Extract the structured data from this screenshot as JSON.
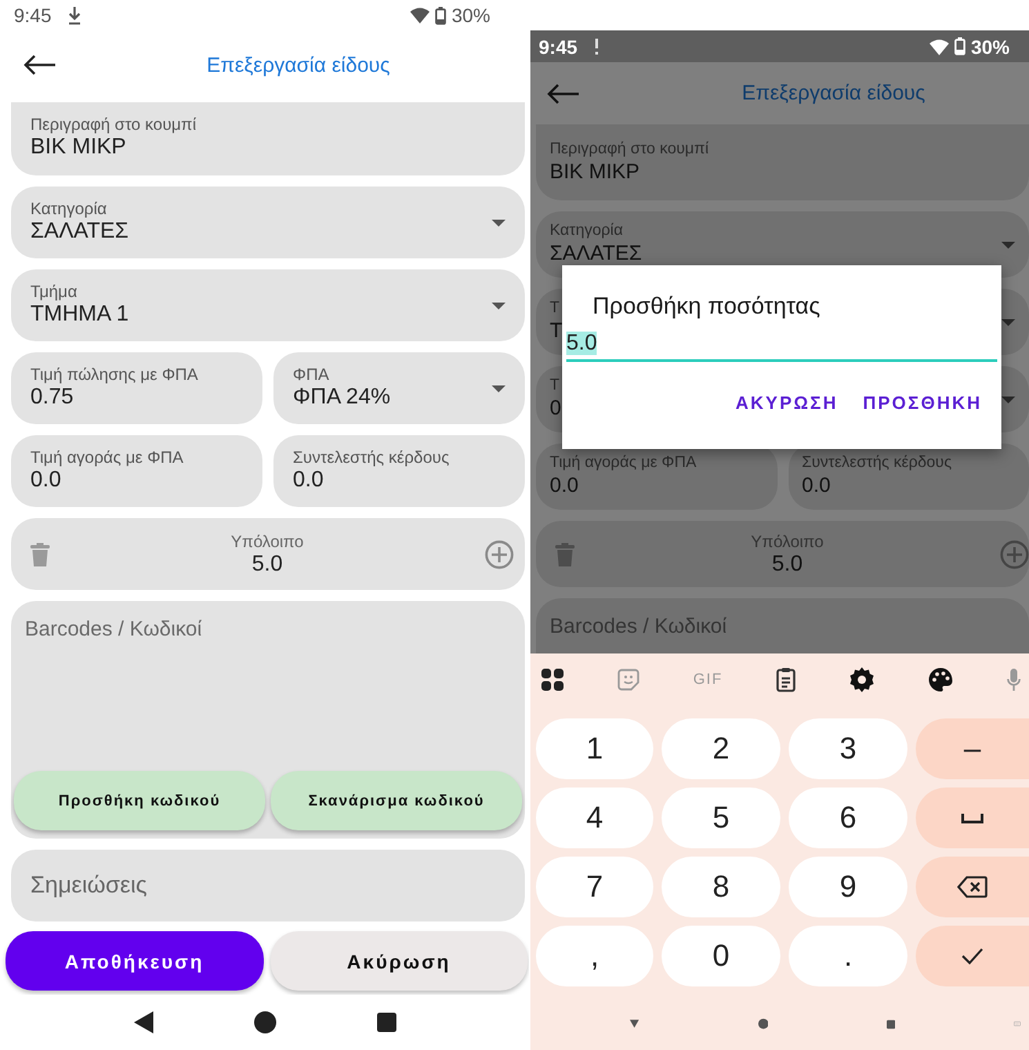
{
  "screens": [
    {
      "dimmed": false,
      "status_bar": {
        "time": "9:45",
        "battery": "30%"
      },
      "app_bar": {
        "title": "Επεξεργασία είδους"
      },
      "fields": [
        {
          "kind": "text",
          "label": "Περιγραφή στο κουμπί",
          "value": "ΒΙΚ ΜΙΚΡ"
        },
        {
          "kind": "dropdown",
          "label": "Κατηγορία",
          "value": "ΣΑΛΑΤΕΣ"
        },
        {
          "kind": "dropdown",
          "label": "Τμήμα",
          "value": "ΤΜΗΜΑ 1"
        },
        {
          "kind": "pair",
          "items": [
            {
              "kind": "text",
              "label": "Τιμή πώλησης με ΦΠΑ",
              "value": "0.75"
            },
            {
              "kind": "dropdown",
              "label": "ΦΠΑ",
              "value": "ΦΠΑ 24%"
            }
          ]
        },
        {
          "kind": "pair",
          "items": [
            {
              "kind": "text",
              "label": "Τιμή αγοράς με ΦΠΑ",
              "value": "0.0"
            },
            {
              "kind": "text",
              "label": "Συντελεστής κέρδους",
              "value": "0.0"
            }
          ]
        },
        {
          "kind": "stock",
          "label": "Υπόλοιπο",
          "value": "5.0"
        },
        {
          "kind": "barcodes",
          "label": "Barcodes / Κωδικοί",
          "buttons": [
            "Προσθήκη κωδικού",
            "Σκανάρισμα κωδικού"
          ]
        },
        {
          "kind": "notes",
          "placeholder": "Σημειώσεις"
        }
      ],
      "actions": [
        {
          "kind": "primary",
          "label": "Αποθήκευση"
        },
        {
          "kind": "secondary",
          "label": "Ακύρωση"
        }
      ]
    },
    {
      "dimmed": true,
      "status_bar": {
        "time": "9:45",
        "battery": "30%"
      },
      "app_bar": {
        "title": "Επεξεργασία είδους"
      },
      "fields": [
        {
          "kind": "text",
          "label": "Περιγραφή στο κουμπί",
          "value": "ΒΙΚ ΜΙΚΡ"
        },
        {
          "kind": "dropdown",
          "label": "Κατηγορία",
          "value": "ΣΑΛΑΤΕΣ"
        },
        {
          "kind": "dropdown",
          "label": "Τ",
          "value": "Τ"
        },
        {
          "kind": "pair",
          "items": [
            {
              "kind": "text",
              "label": "Τ",
              "value": "0"
            },
            {
              "kind": "dropdown"
            }
          ]
        },
        {
          "kind": "pair",
          "items": [
            {
              "kind": "text",
              "label": "Τιμή αγοράς με ΦΠΑ",
              "value": "0.0"
            },
            {
              "kind": "text",
              "label": "Συντελεστής κέρδους",
              "value": "0.0"
            }
          ]
        },
        {
          "kind": "stock",
          "label": "Υπόλοιπο",
          "value": "5.0"
        },
        {
          "kind": "barcodes",
          "label": "Barcodes / Κωδικοί"
        }
      ],
      "dialog": {
        "title": "Προσθήκη ποσότητας",
        "value": "5.0",
        "buttons": [
          "ΑΚΥΡΩΣΗ",
          "ΠΡΟΣΘΗΚΗ"
        ]
      },
      "keyboard": {
        "gif_label": "GIF",
        "keys": [
          {
            "kind": "digit",
            "label": "1"
          },
          {
            "kind": "digit",
            "label": "2"
          },
          {
            "kind": "digit",
            "label": "3"
          },
          {
            "kind": "symbol",
            "label": "–"
          },
          {
            "kind": "digit",
            "label": "4"
          },
          {
            "kind": "digit",
            "label": "5"
          },
          {
            "kind": "digit",
            "label": "6"
          },
          {
            "kind": "space"
          },
          {
            "kind": "digit",
            "label": "7"
          },
          {
            "kind": "digit",
            "label": "8"
          },
          {
            "kind": "digit",
            "label": "9"
          },
          {
            "kind": "backspace"
          },
          {
            "kind": "digit",
            "label": ","
          },
          {
            "kind": "digit",
            "label": "0"
          },
          {
            "kind": "digit",
            "label": "."
          },
          {
            "kind": "done"
          }
        ]
      }
    }
  ]
}
